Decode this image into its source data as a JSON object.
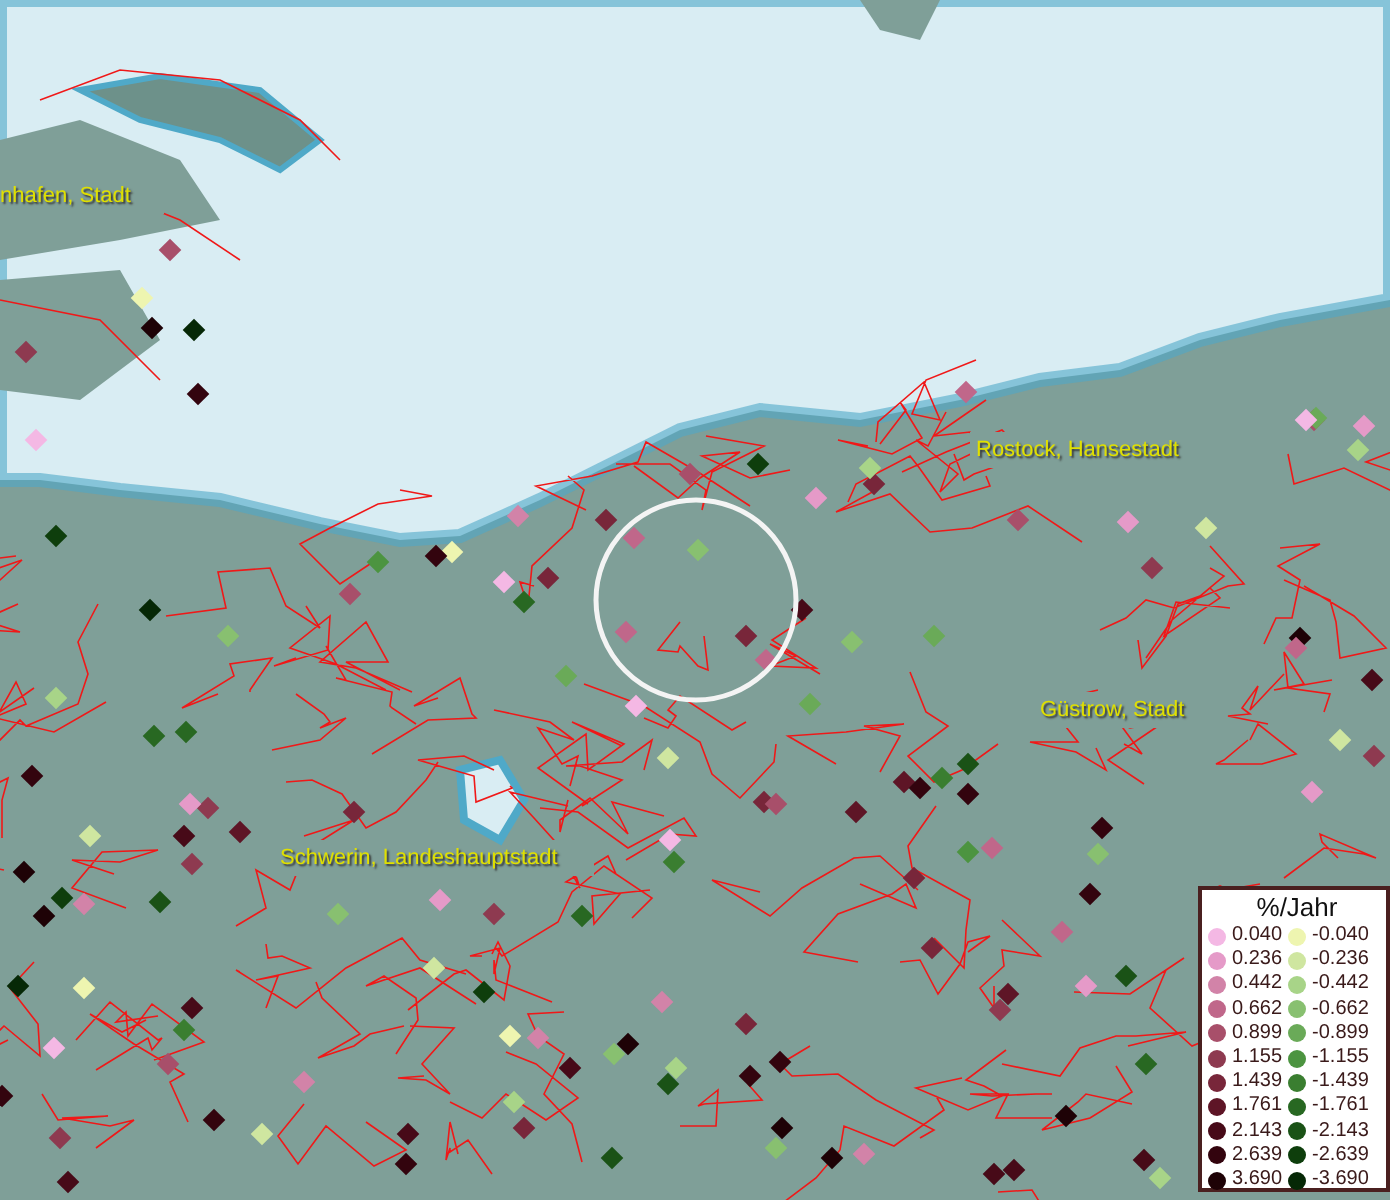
{
  "map": {
    "place_labels": [
      {
        "label": "nhafen, Stadt"
      },
      {
        "label": "Rostock, Hansestadt"
      },
      {
        "label": "Güstrow, Stadt"
      },
      {
        "label": "Schwerin, Landeshauptstadt"
      }
    ]
  },
  "legend": {
    "title": "%/Jahr",
    "entries": [
      {
        "value": "0.040",
        "color": "#f4b8e4"
      },
      {
        "value": "-0.040",
        "color": "#eef5b0"
      },
      {
        "value": "0.236",
        "color": "#e59ac8"
      },
      {
        "value": "-0.236",
        "color": "#cfe6a0"
      },
      {
        "value": "0.442",
        "color": "#d283a8"
      },
      {
        "value": "-0.442",
        "color": "#a8d488"
      },
      {
        "value": "0.662",
        "color": "#c0678a"
      },
      {
        "value": "-0.662",
        "color": "#88c070"
      },
      {
        "value": "0.899",
        "color": "#a84f6a"
      },
      {
        "value": "-0.899",
        "color": "#6aaa58"
      },
      {
        "value": "1.155",
        "color": "#8e3a50"
      },
      {
        "value": "-1.155",
        "color": "#4c9440"
      },
      {
        "value": "1.439",
        "color": "#78263a"
      },
      {
        "value": "-1.439",
        "color": "#3a7e30"
      },
      {
        "value": "1.761",
        "color": "#5e1526"
      },
      {
        "value": "-1.761",
        "color": "#286822"
      },
      {
        "value": "2.143",
        "color": "#470a18"
      },
      {
        "value": "-2.143",
        "color": "#1a5216"
      },
      {
        "value": "2.639",
        "color": "#33040e"
      },
      {
        "value": "-2.639",
        "color": "#0e3e0c"
      },
      {
        "value": "3.690",
        "color": "#1e0206"
      },
      {
        "value": "-3.690",
        "color": "#062806"
      }
    ]
  }
}
